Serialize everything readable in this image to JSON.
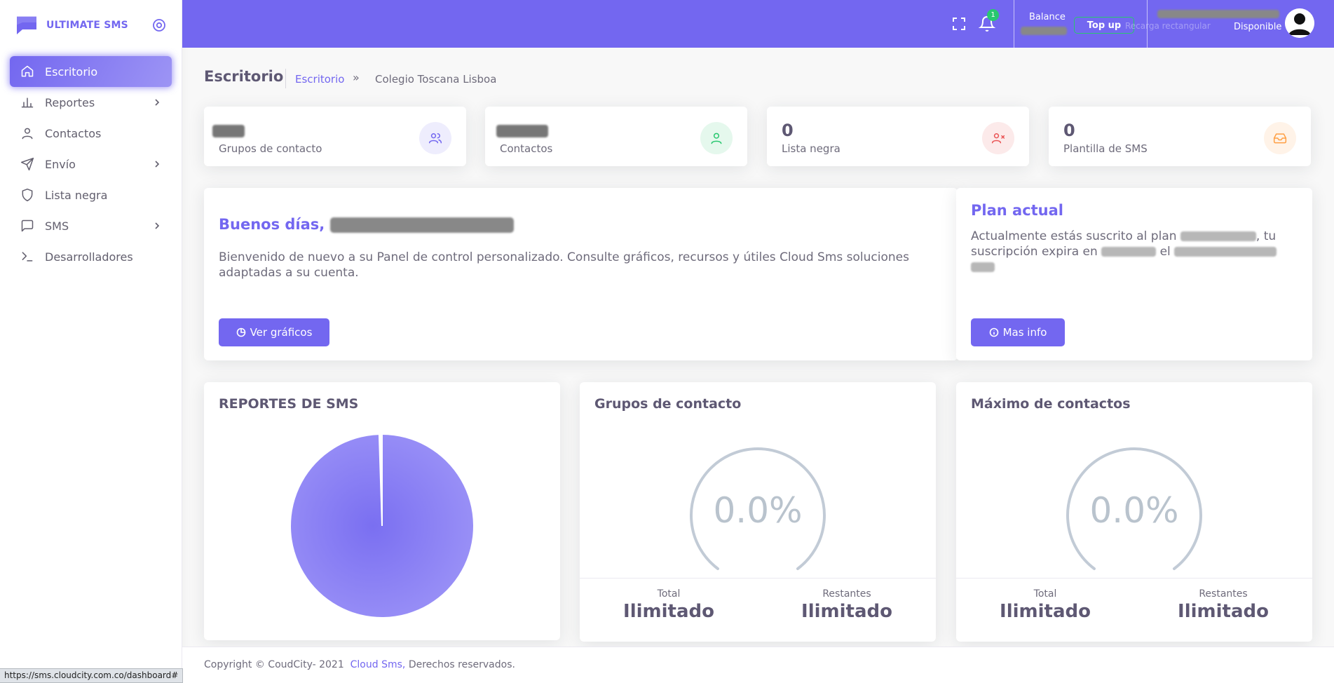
{
  "brand": {
    "name": "ULTIMATE SMS"
  },
  "sidebar": {
    "items": [
      {
        "label": "Escritorio",
        "icon": "home-icon",
        "active": true
      },
      {
        "label": "Reportes",
        "icon": "bar-chart-icon",
        "has_submenu": true
      },
      {
        "label": "Contactos",
        "icon": "user-icon"
      },
      {
        "label": "Envío",
        "icon": "send-icon",
        "has_submenu": true
      },
      {
        "label": "Lista negra",
        "icon": "shield-icon"
      },
      {
        "label": "SMS",
        "icon": "message-square-icon",
        "has_submenu": true
      },
      {
        "label": "Desarrolladores",
        "icon": "terminal-icon"
      }
    ]
  },
  "topbar": {
    "notification_count": "1",
    "balance_label": "Balance",
    "topup_label": "Top up",
    "faint_text": "Recarga rectangular",
    "status_label": "Disponible"
  },
  "header": {
    "title": "Escritorio",
    "breadcrumb": {
      "link": "Escritorio",
      "separator": "»",
      "current": "Colegio Toscana Lisboa"
    }
  },
  "stats": [
    {
      "value": "",
      "label": "Grupos de contacto",
      "icon": "users-icon",
      "color": "#7367f0",
      "bg": "#eeedfd"
    },
    {
      "value": "",
      "label": "Contactos",
      "icon": "user-icon",
      "color": "#28c76f",
      "bg": "#e5f8ed"
    },
    {
      "value": "0",
      "label": "Lista negra",
      "icon": "user-x-icon",
      "color": "#ea5455",
      "bg": "#fceaea"
    },
    {
      "value": "0",
      "label": "Plantilla de SMS",
      "icon": "inbox-icon",
      "color": "#ff9f43",
      "bg": "#fff3e8"
    }
  ],
  "greeting": {
    "title": "Buenos días,",
    "body": "Bienvenido de nuevo a su Panel de control personalizado. Consulte gráficos, recursos y útiles Cloud Sms soluciones adaptadas a su cuenta.",
    "button": "Ver gráficos"
  },
  "plan": {
    "title": "Plan actual",
    "body_part1": "Actualmente estás suscrito al plan",
    "body_part2": ", tu suscripción expira en",
    "body_part3": "el",
    "button": "Mas info"
  },
  "sms_report": {
    "title": "REPORTES DE SMS"
  },
  "contact_groups": {
    "title": "Grupos de contacto",
    "percent": "0.0%",
    "total_label": "Total",
    "total_value": "Ilimitado",
    "remaining_label": "Restantes",
    "remaining_value": "Ilimitado"
  },
  "max_contacts": {
    "title": "Máximo de contactos",
    "percent": "0.0%",
    "total_label": "Total",
    "total_value": "Ilimitado",
    "remaining_label": "Restantes",
    "remaining_value": "Ilimitado"
  },
  "footer": {
    "copyright": "Copyright © CoudCity- 2021",
    "link": "Cloud Sms,",
    "rights": "Derechos reservados."
  },
  "status_bar": {
    "url": "https://sms.cloudcity.com.co/dashboard#"
  },
  "chart_data": [
    {
      "type": "pie",
      "title": "REPORTES DE SMS",
      "values": [
        99.5,
        0.5
      ],
      "colors": [
        "#7367f0",
        "#ffffff"
      ]
    },
    {
      "type": "radialBar",
      "title": "Grupos de contacto",
      "values": [
        0.0
      ],
      "unit": "%"
    },
    {
      "type": "radialBar",
      "title": "Máximo de contactos",
      "values": [
        0.0
      ],
      "unit": "%"
    }
  ]
}
